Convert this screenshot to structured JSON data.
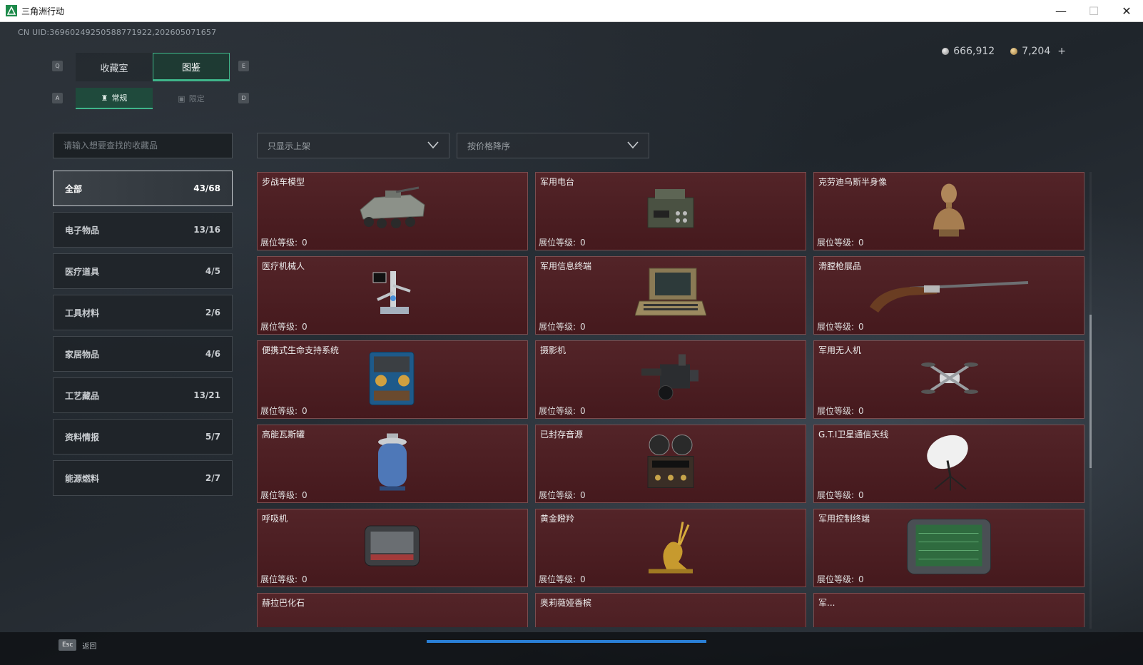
{
  "window": {
    "title": "三角洲行动",
    "minimize": "—",
    "maximize": "☐",
    "close": "✕"
  },
  "uid": "CN UID:36960249250588771922,202605071657",
  "currency": {
    "silver": "666,912",
    "gold": "7,204",
    "plus": "+"
  },
  "keys": {
    "prev_tab": "Q",
    "next_tab": "E",
    "prev_sub": "A",
    "next_sub": "D",
    "esc": "Esc"
  },
  "tabs": [
    {
      "label": "收藏室"
    },
    {
      "label": "图鉴"
    }
  ],
  "subtabs": [
    {
      "label": "常规"
    },
    {
      "label": "限定"
    }
  ],
  "search": {
    "placeholder": "请输入想要查找的收藏品"
  },
  "filters": {
    "listing": "只显示上架",
    "sort": "按价格降序"
  },
  "categories": [
    {
      "name": "全部",
      "count": "43/68"
    },
    {
      "name": "电子物品",
      "count": "13/16"
    },
    {
      "name": "医疗道具",
      "count": "4/5"
    },
    {
      "name": "工具材料",
      "count": "2/6"
    },
    {
      "name": "家居物品",
      "count": "4/6"
    },
    {
      "name": "工艺藏品",
      "count": "13/21"
    },
    {
      "name": "资料情报",
      "count": "5/7"
    },
    {
      "name": "能源燃料",
      "count": "2/7"
    }
  ],
  "level_label": "展位等级:",
  "items": [
    {
      "name": "步战车模型",
      "level": "0",
      "icon": "ifv-model-icon"
    },
    {
      "name": "军用电台",
      "level": "0",
      "icon": "military-radio-icon"
    },
    {
      "name": "克劳迪乌斯半身像",
      "level": "0",
      "icon": "bust-statue-icon"
    },
    {
      "name": "医疗机械人",
      "level": "0",
      "icon": "medical-robot-icon"
    },
    {
      "name": "军用信息终端",
      "level": "0",
      "icon": "info-terminal-icon"
    },
    {
      "name": "滑膛枪展品",
      "level": "0",
      "icon": "musket-icon"
    },
    {
      "name": "便携式生命支持系统",
      "level": "0",
      "icon": "life-support-icon"
    },
    {
      "name": "摄影机",
      "level": "0",
      "icon": "camera-icon"
    },
    {
      "name": "军用无人机",
      "level": "0",
      "icon": "drone-icon"
    },
    {
      "name": "高能瓦斯罐",
      "level": "0",
      "icon": "gas-tank-icon"
    },
    {
      "name": "已封存音源",
      "level": "0",
      "icon": "reel-recorder-icon"
    },
    {
      "name": "G.T.I卫星通信天线",
      "level": "0",
      "icon": "satellite-dish-icon"
    },
    {
      "name": "呼吸机",
      "level": "0",
      "icon": "ventilator-icon"
    },
    {
      "name": "黄金瞪羚",
      "level": "0",
      "icon": "golden-gazelle-icon"
    },
    {
      "name": "军用控制终端",
      "level": "0",
      "icon": "control-terminal-icon"
    }
  ],
  "partial_items": [
    {
      "name": "赫拉巴化石"
    },
    {
      "name": "奥莉薇娅香槟"
    },
    {
      "name": "军..."
    }
  ],
  "bottom": {
    "back_label": "返回"
  }
}
